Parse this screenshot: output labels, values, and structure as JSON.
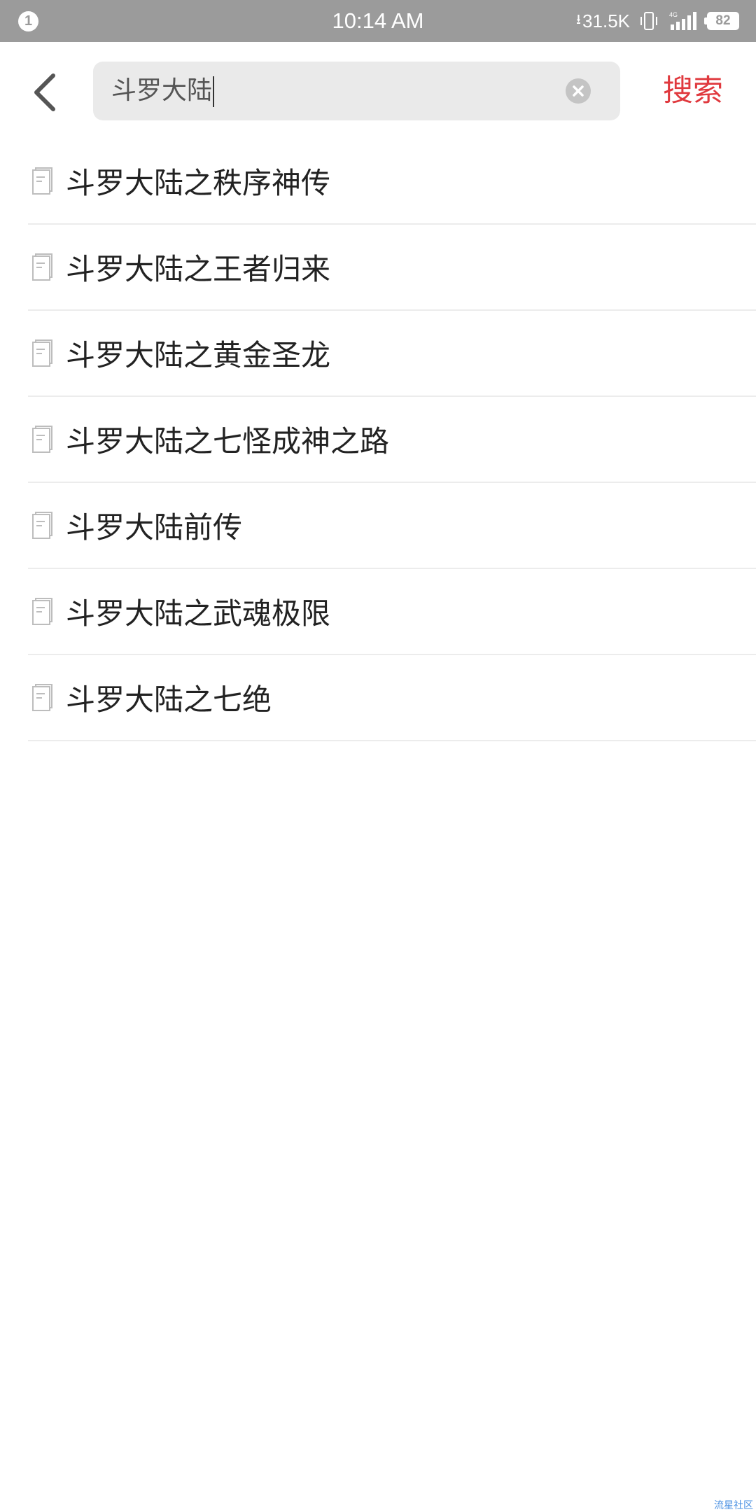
{
  "status_bar": {
    "notification_count": "1",
    "time": "10:14 AM",
    "net_speed": "31.5K",
    "network_type": "4G",
    "battery": "82"
  },
  "search": {
    "query": "斗罗大陆",
    "placeholder": "",
    "submit_label": "搜索"
  },
  "suggestions": [
    {
      "label": "斗罗大陆之秩序神传"
    },
    {
      "label": "斗罗大陆之王者归来"
    },
    {
      "label": "斗罗大陆之黄金圣龙"
    },
    {
      "label": "斗罗大陆之七怪成神之路"
    },
    {
      "label": "斗罗大陆前传"
    },
    {
      "label": "斗罗大陆之武魂极限"
    },
    {
      "label": "斗罗大陆之七绝"
    }
  ],
  "watermark": "流星社区",
  "colors": {
    "accent": "#e0393e",
    "status_bar": "#9b9b9b",
    "search_box": "#eaeaea"
  },
  "icons": {
    "back": "chevron-left-icon",
    "clear": "clear-icon",
    "suggestion": "book-icon"
  }
}
